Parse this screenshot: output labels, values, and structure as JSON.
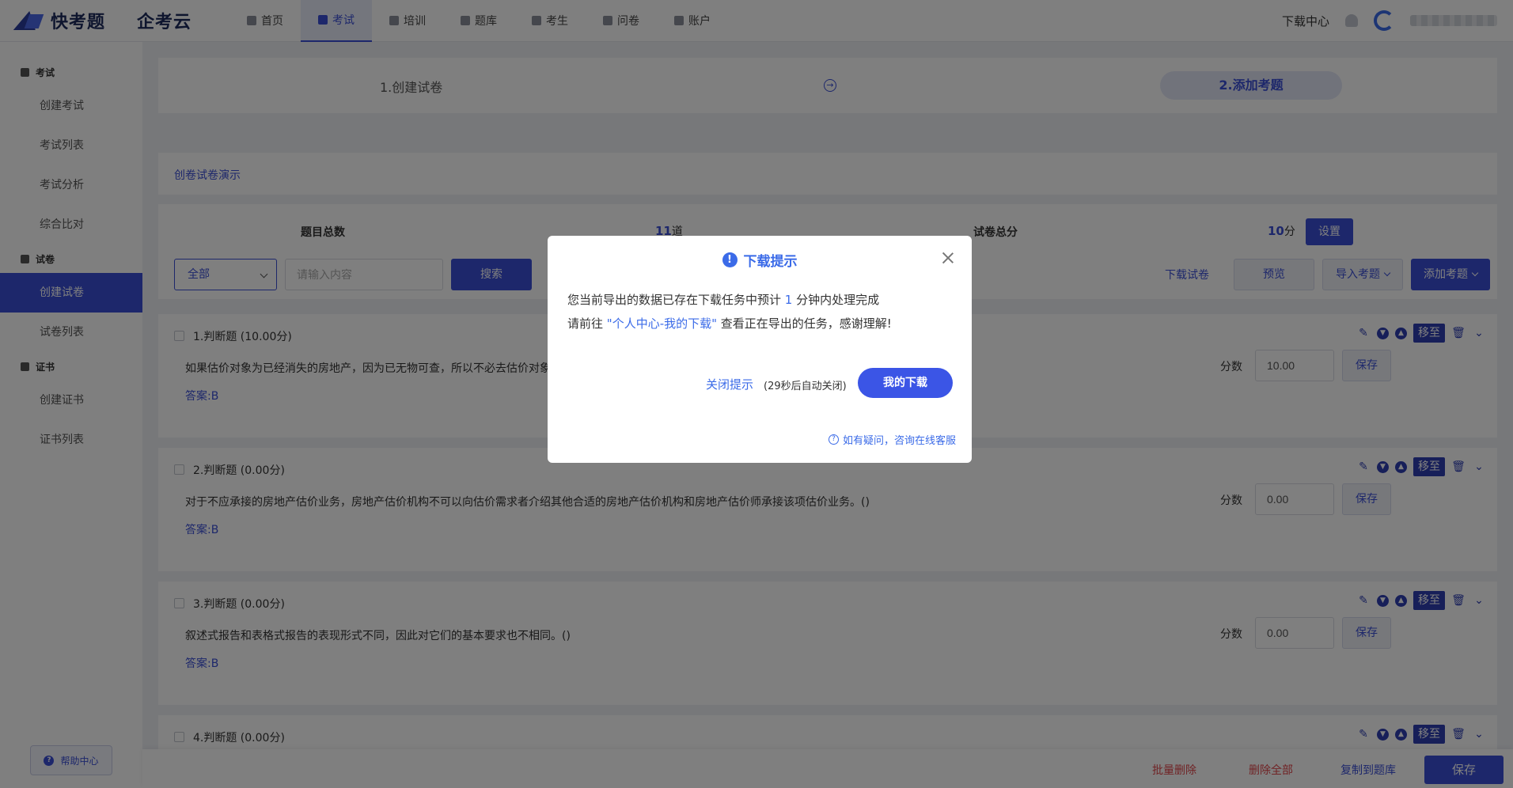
{
  "header": {
    "logo_text": "快考题",
    "logo_text2": "企考云",
    "nav": [
      {
        "label": "首页"
      },
      {
        "label": "考试"
      },
      {
        "label": "培训"
      },
      {
        "label": "题库"
      },
      {
        "label": "考生"
      },
      {
        "label": "问卷"
      },
      {
        "label": "账户"
      }
    ],
    "download_center": "下载中心"
  },
  "sidebar": {
    "groups": [
      {
        "label": "考试",
        "items": [
          "创建考试",
          "考试列表",
          "考试分析",
          "综合比对"
        ]
      },
      {
        "label": "试卷",
        "items": [
          "创建试卷",
          "试卷列表"
        ]
      },
      {
        "label": "证书",
        "items": [
          "创建证书",
          "证书列表"
        ]
      }
    ],
    "help": "帮助中心"
  },
  "steps": {
    "step1": "1.创建试卷",
    "step2": "2.添加考题"
  },
  "demo_link": "创卷试卷演示",
  "toolbar": {
    "total_label": "题目总数",
    "total_value": "11",
    "total_unit": "道",
    "score_label": "试卷总分",
    "score_value": "10",
    "score_unit": "分",
    "settings": "设置",
    "filter_value": "全部",
    "search_placeholder": "请输入内容",
    "search_button": "搜索",
    "download_paper": "下载试卷",
    "preview": "预览",
    "import": "导入考题",
    "add": "添加考题"
  },
  "questions": [
    {
      "title": "1.判断题 (10.00分)",
      "text": "如果估价对象为已经消失的房地产，因为已无物可查，所以不必去估价对象",
      "answer": "答案:B",
      "score_label": "分数",
      "score": "10.00",
      "save": "保存",
      "move": "移至"
    },
    {
      "title": "2.判断题 (0.00分)",
      "text": "对于不应承接的房地产估价业务，房地产估价机构不可以向估价需求者介绍其他合适的房地产估价机构和房地产估价师承接该项估价业务。()",
      "answer": "答案:B",
      "score_label": "分数",
      "score": "0.00",
      "save": "保存",
      "move": "移至"
    },
    {
      "title": "3.判断题 (0.00分)",
      "text": "叙述式报告和表格式报告的表现形式不同，因此对它们的基本要求也不相同。()",
      "answer": "答案:B",
      "score_label": "分数",
      "score": "0.00",
      "save": "保存",
      "move": "移至"
    },
    {
      "title": "4.判断题 (0.00分)",
      "move": "移至"
    }
  ],
  "footer": {
    "batch_delete": "批量删除",
    "delete_all": "删除全部",
    "copy_to_bank": "复制到题库",
    "save": "保存"
  },
  "modal": {
    "title": "下载提示",
    "line1_a": "您当前导出的数据已存在下载任务中预计",
    "line1_num": "1",
    "line1_b": "分钟内处理完成",
    "line2_a": "请前往",
    "line2_link": "\"个人中心-我的下载\"",
    "line2_b": "查看正在导出的任务，感谢理解!",
    "close_link": "关闭提示",
    "countdown": "(29秒后自动关闭)",
    "my_downloads": "我的下载",
    "help": "如有疑问，咨询在线客服"
  },
  "colors": {
    "primary": "#3b4fd6",
    "danger": "#e0464b",
    "link": "#3b6be8"
  }
}
